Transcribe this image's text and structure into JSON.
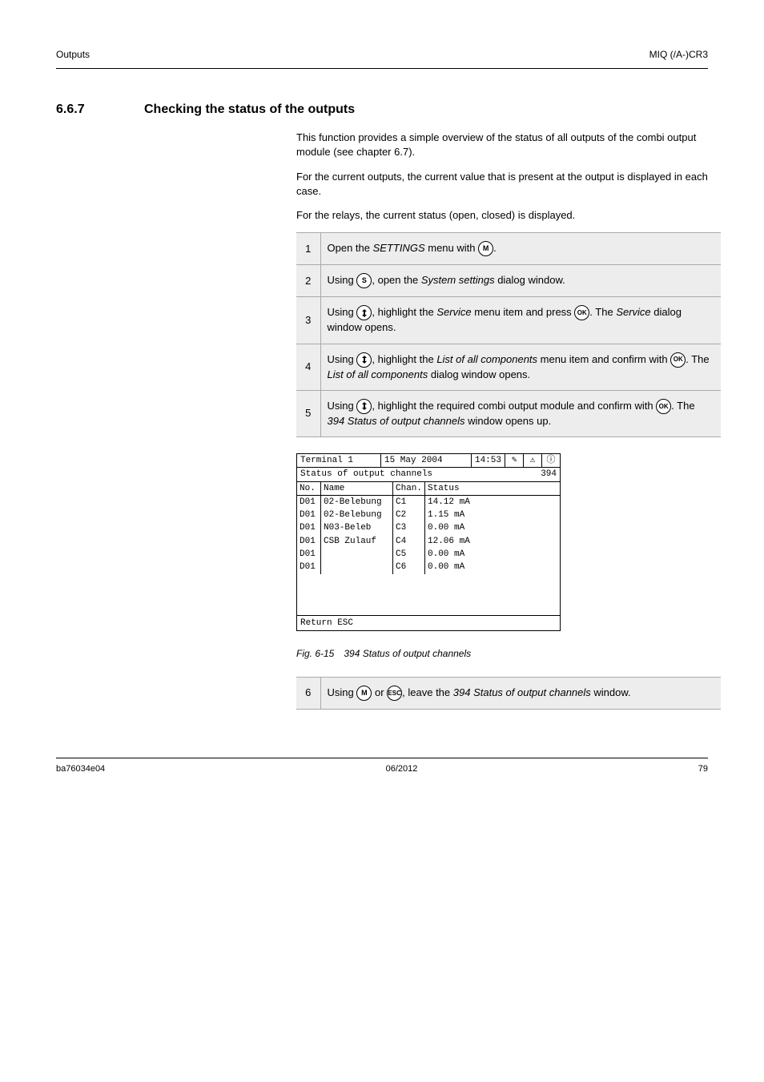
{
  "header": {
    "left": "Outputs",
    "right": "MIQ (/A-)CR3"
  },
  "sec1": {
    "num": "6.6.7",
    "title": "Checking the status of the outputs"
  },
  "p1": "This function provides a simple overview of the status of all outputs of the combi output module (see chapter 6.7).",
  "p1b": "For the current outputs, the current value that is present at the output is displayed in each case.",
  "p1c": "For the relays, the current status (open, closed) is displayed.",
  "steps": [
    {
      "n": "1",
      "text_before": "Open the ",
      "key": "M",
      "italic": "SETTINGS",
      "text_after": " menu with "
    },
    {
      "n": "2",
      "text_before": "Using ",
      "key": "S",
      "italic": "System settings",
      "text_after": ", open the ",
      "text_end": " dialog window."
    },
    {
      "n": "3",
      "text_before": "Using ",
      "key1": "arrow",
      "text_mid": ", highlight the ",
      "italic": "Service",
      "text_after2": " menu item and press ",
      "key2": "OK",
      "text_end": ". The ",
      "italic2": "Service",
      "text_end2": " dialog window opens."
    },
    {
      "n": "4",
      "text_before": "Using ",
      "key1": "arrow",
      "text_mid": ", highlight the ",
      "italic": "List of all components",
      "text_after2": " menu item and confirm with ",
      "key2": "OK",
      "text_end": ". The ",
      "italic2": "List of all components",
      "text_end2": " dialog window opens."
    },
    {
      "n": "5",
      "text_before": "Using ",
      "key1": "arrow",
      "text_mid": ", highlight the required combi output module and confirm with ",
      "key2": "OK",
      "text_end": ". The ",
      "italic": "394 Status of output channels",
      "text_end2": " window opens up."
    }
  ],
  "screen": {
    "terminal": "Terminal 1",
    "date": "15 May  2004",
    "time": "14:53",
    "subtitle": "Status of output channels",
    "subcode": "394",
    "cols": [
      "No.",
      "Name",
      "Chan.",
      "Status"
    ],
    "rows": [
      {
        "no": "D01",
        "name": "02-Belebung",
        "chan": "C1",
        "status": "14.12 mA"
      },
      {
        "no": "D01",
        "name": "02-Belebung",
        "chan": "C2",
        "status": "1.15 mA"
      },
      {
        "no": "D01",
        "name": "N03-Beleb",
        "chan": "C3",
        "status": "0.00 mA"
      },
      {
        "no": "D01",
        "name": "CSB Zulauf",
        "chan": "C4",
        "status": "12.06 mA"
      },
      {
        "no": "D01",
        "name": "",
        "chan": "C5",
        "status": "0.00 mA"
      },
      {
        "no": "D01",
        "name": "",
        "chan": "C6",
        "status": "0.00 mA"
      }
    ],
    "footer": "Return ESC"
  },
  "caption": "Fig. 6-15 394 Status of output channels",
  "step6": {
    "n": "6",
    "text_before": "Using ",
    "key1": "M",
    "text_mid": " or ",
    "key2": "ESC",
    "text_after": ", leave the ",
    "italic": "394 Status of output channels",
    "text_end": " window."
  },
  "footer": {
    "left": "ba76034e04",
    "mid": "06/2012",
    "right": "79"
  }
}
